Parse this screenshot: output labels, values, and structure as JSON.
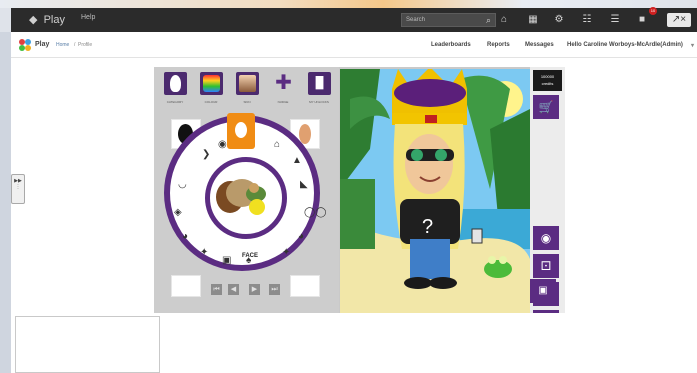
{
  "topbar": {
    "logo": "Play",
    "help": "Help",
    "search_placeholder": "Search",
    "notification_count": "10"
  },
  "header": {
    "brand": "Play",
    "breadcrumb": [
      "Home",
      "Profile"
    ],
    "nav": [
      "Leaderboards",
      "Reports",
      "Messages"
    ],
    "user": "Hello Caroline Worboys-McArdle(Admin)"
  },
  "game": {
    "tabs": [
      "CATEGORY",
      "COLOUR",
      "SKIN",
      "NUDGE",
      "MY UNLOCKS"
    ],
    "wheel_label": "FACE",
    "credits": [
      "100000",
      "credits"
    ]
  }
}
